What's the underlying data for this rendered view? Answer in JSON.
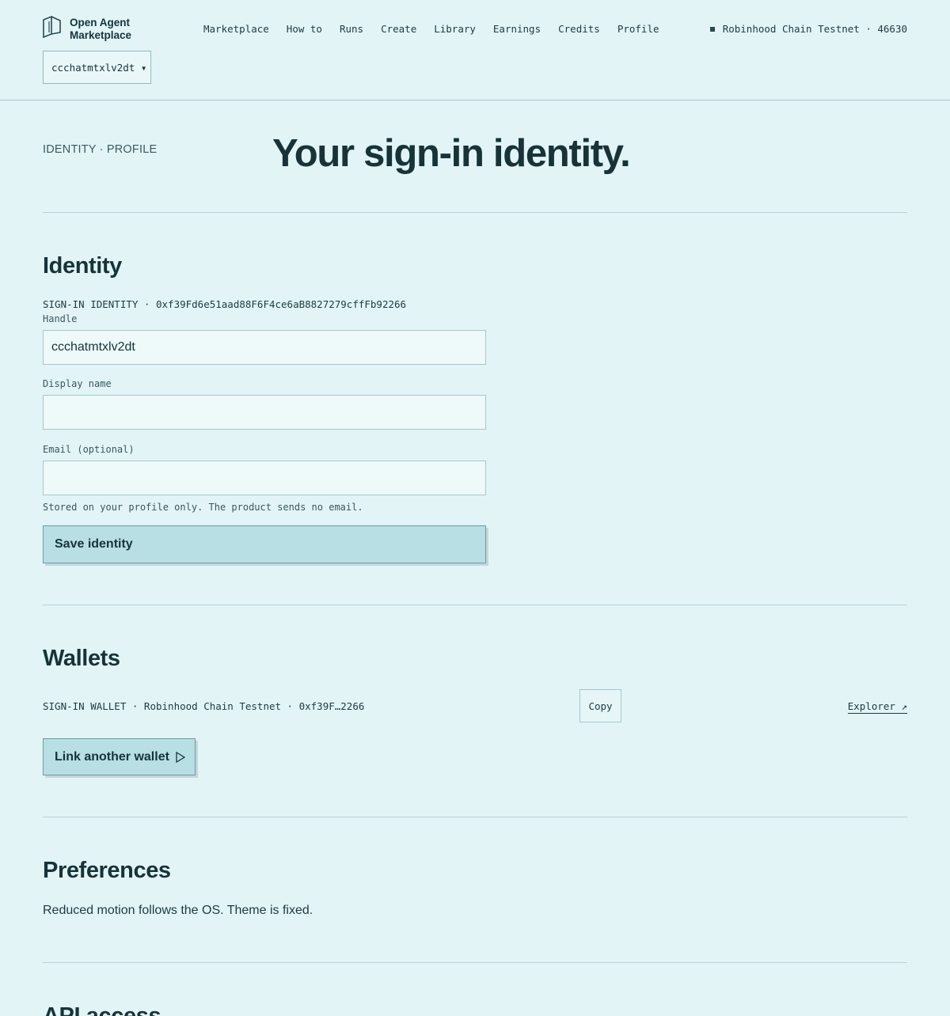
{
  "brand": {
    "name_line1": "Open Agent",
    "name_line2": "Marketplace",
    "logo_icon": "book-icon"
  },
  "nav": [
    "Marketplace",
    "How to",
    "Runs",
    "Create",
    "Library",
    "Earnings",
    "Credits",
    "Profile"
  ],
  "network": {
    "label": "Robinhood Chain Testnet · 46630"
  },
  "account": {
    "handle": "ccchatmtxlv2dt ▾"
  },
  "hero": {
    "eyebrow": "IDENTITY · PROFILE",
    "title": "Your sign-in identity."
  },
  "identity": {
    "title": "Identity",
    "meta": "SIGN-IN IDENTITY · 0xf39Fd6e51aad88F6F4ce6aB8827279cffFb92266",
    "handle_label": "Handle",
    "handle_value": "ccchatmtxlv2dt",
    "display_label": "Display name",
    "display_value": "",
    "email_label": "Email (optional)",
    "email_value": "",
    "email_note": "Stored on your profile only. The product sends no email.",
    "save_label": "Save identity"
  },
  "wallets": {
    "title": "Wallets",
    "meta": "SIGN-IN WALLET · Robinhood Chain Testnet · 0xf39F…2266",
    "copy_label": "Copy",
    "explorer_label": "Explorer ↗",
    "link_label": "Link another wallet"
  },
  "preferences": {
    "title": "Preferences",
    "text": "Reduced motion follows the OS. Theme is fixed."
  },
  "api": {
    "title": "API access"
  }
}
